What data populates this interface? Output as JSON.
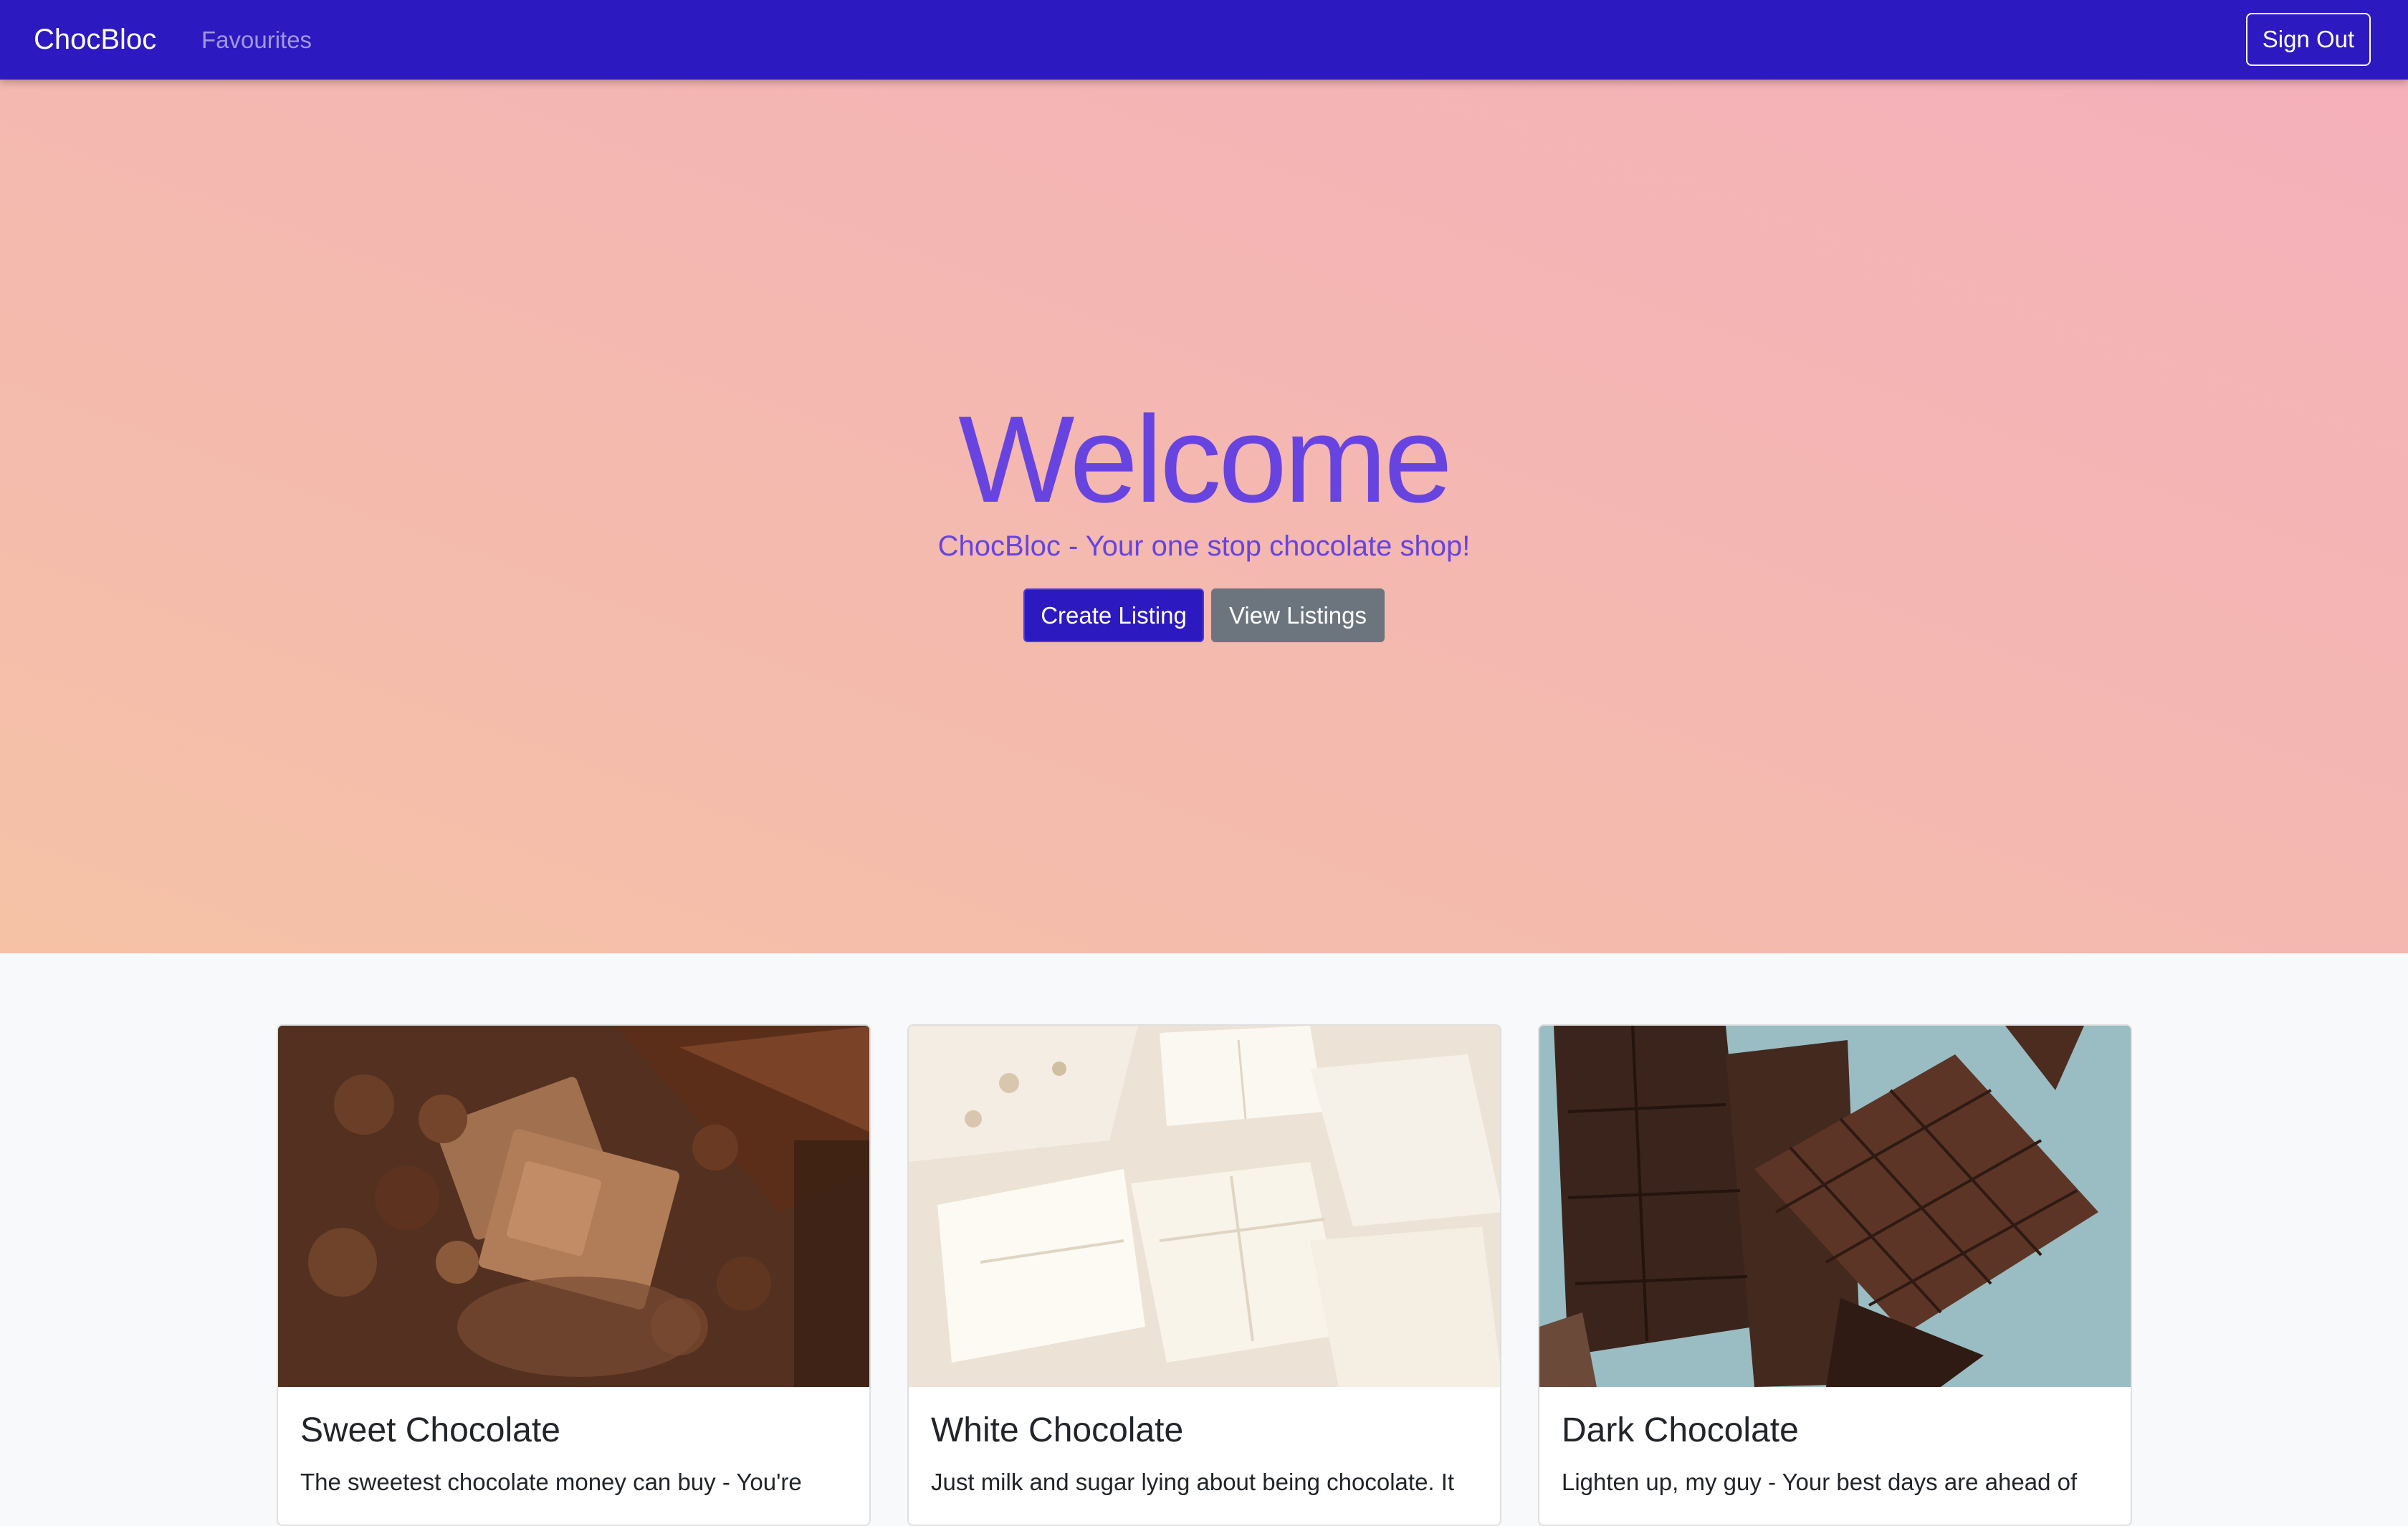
{
  "navbar": {
    "brand": "ChocBloc",
    "links": [
      "Favourites"
    ],
    "sign_out_label": "Sign Out",
    "color": "#2d19c0"
  },
  "hero": {
    "title": "Welcome",
    "subtitle": "ChocBloc - Your one stop chocolate shop!",
    "primary_button": "Create Listing",
    "secondary_button": "View Listings",
    "accent_color": "#6744e0"
  },
  "cards": [
    {
      "title": "Sweet Chocolate",
      "text": "The sweetest chocolate money can buy - You're",
      "image": "milk-chocolate-with-hazelnuts-photo"
    },
    {
      "title": "White Chocolate",
      "text": "Just milk and sugar lying about being chocolate. It",
      "image": "white-chocolate-pieces-photo"
    },
    {
      "title": "Dark Chocolate",
      "text": "Lighten up, my guy - Your best days are ahead of",
      "image": "dark-chocolate-bar-photo"
    }
  ]
}
